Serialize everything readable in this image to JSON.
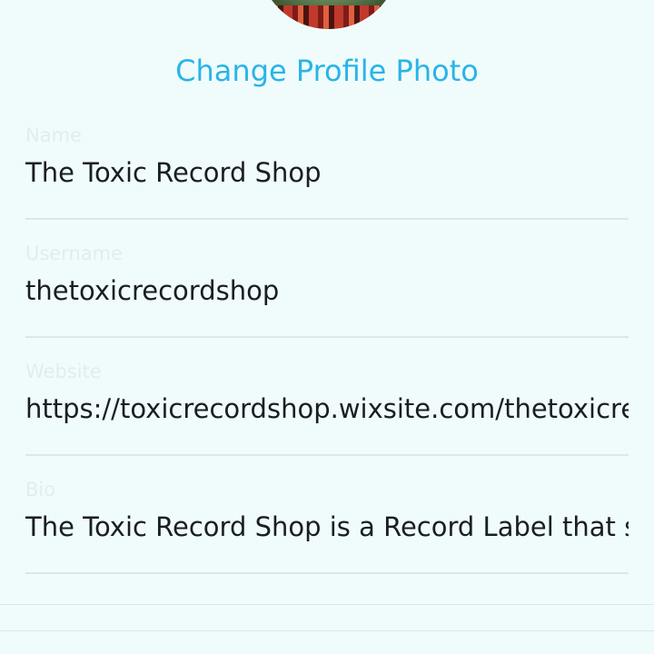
{
  "profile": {
    "change_photo_label": "Change Profile Photo"
  },
  "fields": [
    {
      "label": "Name",
      "value": "The Toxic Record Shop"
    },
    {
      "label": "Username",
      "value": "thetoxicrecordshop"
    },
    {
      "label": "Website",
      "value": "https://toxicrecordshop.wixsite.com/thetoxicrec"
    },
    {
      "label": "Bio",
      "value": "The Toxic Record Shop is a Record Label that su"
    }
  ],
  "colors": {
    "background": "#f0fcfc",
    "accent": "#2ab4e8",
    "text": "#1b1e21",
    "label": "#e3ecec",
    "divider": "#dde7e7"
  }
}
